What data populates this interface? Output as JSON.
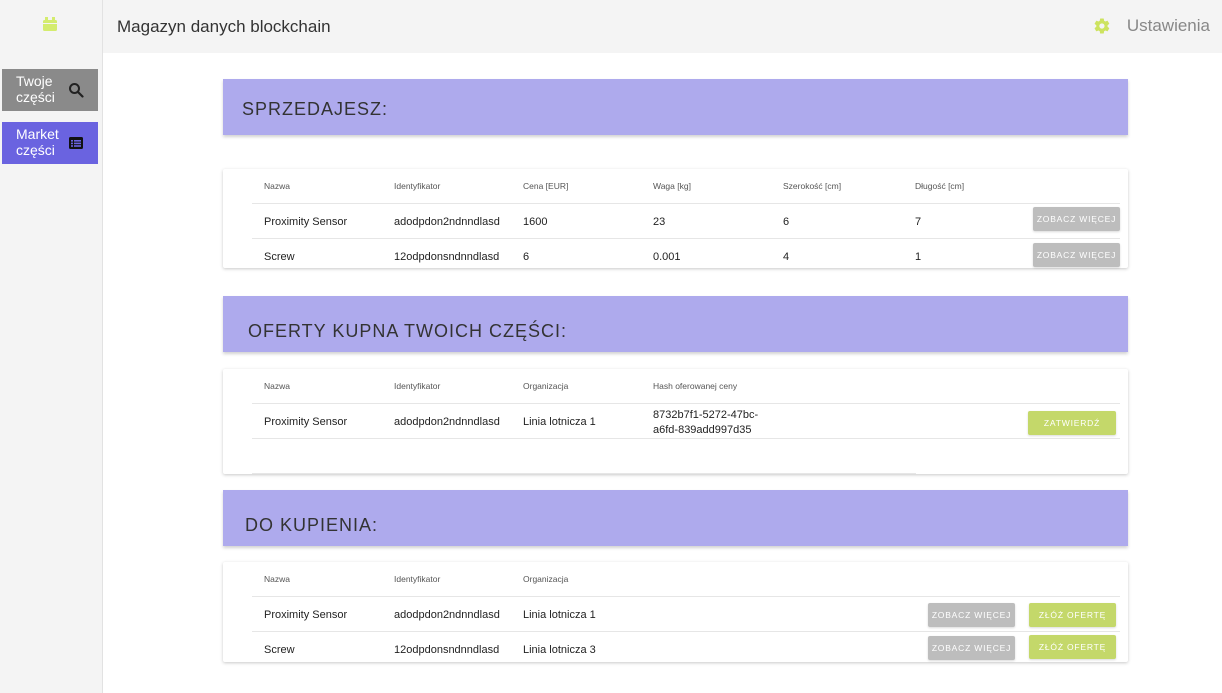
{
  "header": {
    "title": "Magazyn danych blockchain",
    "settings_label": "Ustawienia"
  },
  "sidebar": {
    "items": [
      {
        "label": "Twoje części",
        "icon": "search-icon"
      },
      {
        "label": "Market części",
        "icon": "list-icon"
      }
    ]
  },
  "colors": {
    "accent_header": "#aeaaed",
    "nav_active": "#6a63e0",
    "button_green": "#c4d86a",
    "button_grey": "#bdbdbd",
    "logo": "#d4ec6e"
  },
  "selling": {
    "title": "SPRZEDAJESZ:",
    "columns": [
      "Nazwa",
      "Identyfikator",
      "Cena [EUR]",
      "Waga [kg]",
      "Szerokość [cm]",
      "Długość [cm]"
    ],
    "rows": [
      [
        "Proximity Sensor",
        "adodpdon2ndnndlasd",
        "1600",
        "23",
        "6",
        "7"
      ],
      [
        "Screw",
        "12odpdonsndnndlasd",
        "6",
        "0.001",
        "4",
        "1"
      ]
    ],
    "button_label": "ZOBACZ WIĘCEJ"
  },
  "offers": {
    "title": "OFERTY KUPNA TWOICH CZĘŚCI:",
    "columns": [
      "Nazwa",
      "Identyfikator",
      "Organizacja",
      "Hash oferowanej ceny"
    ],
    "rows": [
      [
        "Proximity Sensor",
        "adodpdon2ndnndlasd",
        "Linia lotnicza 1",
        "8732b7f1-5272-47bc-",
        "a6fd-839add997d35"
      ]
    ],
    "button_label": "ZATWIERDŹ"
  },
  "buy": {
    "title": "DO KUPIENIA:",
    "columns": [
      "Nazwa",
      "Identyfikator",
      "Organizacja"
    ],
    "rows": [
      [
        "Proximity Sensor",
        "adodpdon2ndnndlasd",
        "Linia lotnicza 1"
      ],
      [
        "Screw",
        "12odpdonsndnndlasd",
        "Linia lotnicza 3"
      ]
    ],
    "more_label": "ZOBACZ WIĘCEJ",
    "offer_label": "ZŁÓŻ OFERTĘ"
  }
}
